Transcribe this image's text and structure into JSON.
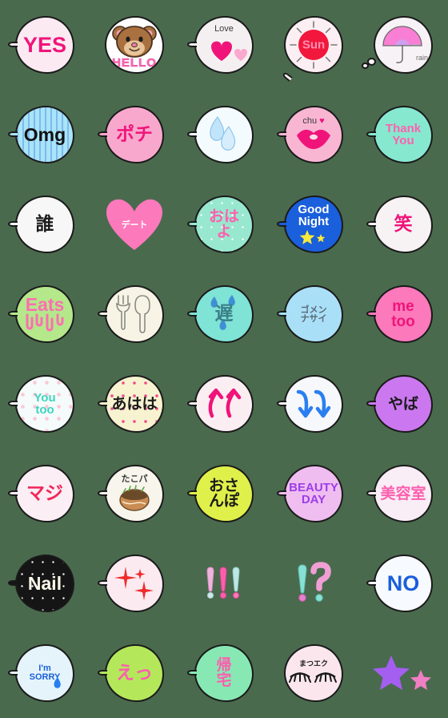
{
  "sheet": {
    "title": "Emoji sticker sheet",
    "columns": 5,
    "rows": 8,
    "background_color": "#4a6a4e",
    "outline_color": "#1a1a1a"
  },
  "emoji": [
    {
      "id": "yes",
      "row": 1,
      "col": 1,
      "text": "YES",
      "kind": "text",
      "shape": "bubble",
      "bubble_color": "#fbeaf2",
      "text_color": "#f0147a",
      "font_size": "s-xl",
      "script": "en",
      "tail": "left"
    },
    {
      "id": "hello-bear",
      "row": 1,
      "col": 2,
      "text": "HELLO",
      "kind": "bear",
      "shape": "bubble",
      "bubble_color": "#ffffff",
      "text_color": "#ff6bb5",
      "font_size": "s-sm",
      "script": "en",
      "tail": "none"
    },
    {
      "id": "love-hearts",
      "row": 1,
      "col": 3,
      "text": "Love",
      "kind": "hearts",
      "shape": "bubble",
      "bubble_color": "#f4f0f2",
      "text_color": "#3a3a3a",
      "font_size": "s-xs",
      "script": "en",
      "tail": "left"
    },
    {
      "id": "sun",
      "row": 1,
      "col": 4,
      "text": "Sun",
      "kind": "sun",
      "shape": "bubble",
      "bubble_color": "#fbeff3",
      "text_color": "#ff8fb0",
      "font_size": "s-sm",
      "script": "en",
      "tail": "bottom"
    },
    {
      "id": "rain-umbrella",
      "row": 1,
      "col": 5,
      "text": "rain",
      "kind": "umbrella",
      "shape": "bubble",
      "bubble_color": "#f7f2f6",
      "text_color": "#6b6b6b",
      "font_size": "s-xxs",
      "script": "en",
      "tail": "thought"
    },
    {
      "id": "omg",
      "row": 2,
      "col": 1,
      "text": "Omg",
      "kind": "text",
      "shape": "bubble",
      "bubble_color": "#a9e4f7",
      "text_color": "#111111",
      "font_size": "s-lg",
      "script": "en",
      "tail": "left",
      "overlay": "stripes"
    },
    {
      "id": "pochi",
      "row": 2,
      "col": 2,
      "text": "ポチ",
      "kind": "text",
      "shape": "bubble",
      "bubble_color": "#f9a8cd",
      "text_color": "#f0147a",
      "font_size": "s-lg",
      "script": "jp",
      "tail": "left"
    },
    {
      "id": "tears",
      "row": 2,
      "col": 3,
      "text": "",
      "kind": "tears",
      "shape": "bubble",
      "bubble_color": "#f4fbff",
      "text_color": "#6fb7e8",
      "font_size": "s-sm",
      "script": "en",
      "tail": "left"
    },
    {
      "id": "chu-kiss",
      "row": 2,
      "col": 4,
      "text": "chu",
      "kind": "lips",
      "shape": "bubble",
      "bubble_color": "#f9b6d3",
      "text_color": "#3a3a3a",
      "font_size": "s-xs",
      "script": "en",
      "tail": "left"
    },
    {
      "id": "thank-you",
      "row": 2,
      "col": 5,
      "text": "Thank\nYou",
      "kind": "text",
      "shape": "bubble",
      "bubble_color": "#87e8d0",
      "text_color": "#ff5fae",
      "font_size": "s-sm",
      "script": "en",
      "tail": "left"
    },
    {
      "id": "dare",
      "row": 3,
      "col": 1,
      "text": "誰",
      "kind": "text",
      "shape": "bubble",
      "bubble_color": "#f7f7f7",
      "text_color": "#1a1a1a",
      "font_size": "s-lg",
      "script": "jp",
      "tail": "left"
    },
    {
      "id": "date",
      "row": 3,
      "col": 2,
      "text": "デート",
      "kind": "text",
      "shape": "heart",
      "bubble_color": "#fc79bb",
      "text_color": "#ffffff",
      "font_size": "s-xs",
      "script": "jp",
      "tail": "none"
    },
    {
      "id": "ohayo",
      "row": 3,
      "col": 3,
      "text": "おは\nよ",
      "kind": "text",
      "shape": "bubble",
      "bubble_color": "#97e8cf",
      "text_color": "#ff5fae",
      "font_size": "s-md",
      "script": "jp",
      "tail": "left",
      "overlay": "nightdots"
    },
    {
      "id": "good-night",
      "row": 3,
      "col": 4,
      "text": "Good\nNight",
      "kind": "night",
      "shape": "bubble",
      "bubble_color": "#1a5fdb",
      "text_color": "#ffffff",
      "font_size": "s-sm",
      "script": "en",
      "tail": "left"
    },
    {
      "id": "warai",
      "row": 3,
      "col": 5,
      "text": "笑",
      "kind": "text",
      "shape": "bubble",
      "bubble_color": "#f7f2f4",
      "text_color": "#f0147a",
      "font_size": "s-lg",
      "script": "jp",
      "tail": "left"
    },
    {
      "id": "eats",
      "row": 4,
      "col": 1,
      "text": "Eats",
      "kind": "drip",
      "shape": "bubble",
      "bubble_color": "#b4e88b",
      "text_color": "#fc6fb0",
      "font_size": "s-lg",
      "script": "en",
      "tail": "left"
    },
    {
      "id": "fork-spoon",
      "row": 4,
      "col": 2,
      "text": "",
      "kind": "cutlery",
      "shape": "bubble",
      "bubble_color": "#f7f4e6",
      "text_color": "#8a8a82",
      "font_size": "s-sm",
      "script": "en",
      "tail": "left"
    },
    {
      "id": "okure",
      "row": 4,
      "col": 3,
      "text": "遅",
      "kind": "sweat",
      "shape": "bubble",
      "bubble_color": "#7fe3d6",
      "text_color": "#3a7f88",
      "font_size": "s-lg",
      "script": "jp",
      "tail": "left"
    },
    {
      "id": "gomennasai",
      "row": 4,
      "col": 4,
      "text": "ゴメン\nナサイ",
      "kind": "text",
      "shape": "bubble",
      "bubble_color": "#a9e0f7",
      "text_color": "#5a6a7a",
      "font_size": "s-xs",
      "script": "jp",
      "tail": "left"
    },
    {
      "id": "me-too",
      "row": 4,
      "col": 5,
      "text": "me\ntoo",
      "kind": "text",
      "shape": "bubble",
      "bubble_color": "#fc79bb",
      "text_color": "#f0147a",
      "font_size": "s-md",
      "script": "en",
      "tail": "left"
    },
    {
      "id": "you-too",
      "row": 5,
      "col": 1,
      "text": "You\ntoo",
      "kind": "text",
      "shape": "bubble",
      "bubble_color": "#f4fbfa",
      "text_color": "#3fd4bf",
      "font_size": "s-sm",
      "script": "en",
      "tail": "left",
      "overlay": "dots"
    },
    {
      "id": "ahaha",
      "row": 5,
      "col": 2,
      "text": "あはは",
      "kind": "text",
      "shape": "bubble",
      "bubble_color": "#f7f2cf",
      "text_color": "#1a1a1a",
      "font_size": "s-md",
      "script": "jp",
      "tail": "left",
      "overlay": "starfield"
    },
    {
      "id": "up-arrows",
      "row": 5,
      "col": 3,
      "text": "",
      "kind": "arrows-up",
      "shape": "bubble",
      "bubble_color": "#fbeef2",
      "text_color": "#f0147a",
      "font_size": "s-md",
      "script": "en",
      "tail": "left"
    },
    {
      "id": "down-arrows",
      "row": 5,
      "col": 4,
      "text": "",
      "kind": "arrows-down",
      "shape": "bubble",
      "bubble_color": "#f7f8fc",
      "text_color": "#2a7ff0",
      "font_size": "s-md",
      "script": "en",
      "tail": "left"
    },
    {
      "id": "yaba",
      "row": 5,
      "col": 5,
      "text": "やば",
      "kind": "text",
      "shape": "bubble",
      "bubble_color": "#cb78f0",
      "text_color": "#1a1a1a",
      "font_size": "s-md",
      "script": "jp",
      "tail": "left"
    },
    {
      "id": "maji",
      "row": 6,
      "col": 1,
      "text": "マジ",
      "kind": "text",
      "shape": "bubble",
      "bubble_color": "#fbeef4",
      "text_color": "#f0285a",
      "font_size": "s-lg",
      "script": "jp",
      "tail": "left"
    },
    {
      "id": "takopa",
      "row": 6,
      "col": 2,
      "text": "たこパ",
      "kind": "takoyaki",
      "shape": "bubble",
      "bubble_color": "#f7f5ec",
      "text_color": "#3a3a3a",
      "font_size": "s-xs",
      "script": "jp",
      "tail": "left"
    },
    {
      "id": "osanpo",
      "row": 6,
      "col": 3,
      "text": "おさ\nんぽ",
      "kind": "text",
      "shape": "bubble",
      "bubble_color": "#e0f04a",
      "text_color": "#1a1a1a",
      "font_size": "s-md",
      "script": "jp",
      "tail": "left"
    },
    {
      "id": "beauty-day",
      "row": 6,
      "col": 4,
      "text": "BEAUTY\nDAY",
      "kind": "text",
      "shape": "bubble",
      "bubble_color": "#f0bdf0",
      "text_color": "#9b3fe8",
      "font_size": "s-sm",
      "script": "en",
      "tail": "left"
    },
    {
      "id": "biyoushitsu",
      "row": 6,
      "col": 5,
      "text": "美容室",
      "kind": "text",
      "shape": "bubble",
      "bubble_color": "#faeef6",
      "text_color": "#fc5fae",
      "font_size": "s-md",
      "script": "jp",
      "tail": "left"
    },
    {
      "id": "nail",
      "row": 7,
      "col": 1,
      "text": "Nail",
      "kind": "text",
      "shape": "bubble",
      "bubble_color": "#151515",
      "text_color": "#fbf7e8",
      "font_size": "s-lg",
      "script": "en",
      "tail": "left",
      "overlay": "nightdots"
    },
    {
      "id": "sparkles",
      "row": 7,
      "col": 2,
      "text": "",
      "kind": "sparkles",
      "shape": "bubble",
      "bubble_color": "#fbeaf0",
      "text_color": "#f02a2a",
      "font_size": "s-sm",
      "script": "en",
      "tail": "left"
    },
    {
      "id": "exclamations",
      "row": 7,
      "col": 3,
      "text": "!!!",
      "kind": "bangs",
      "shape": "none",
      "bubble_color": "transparent",
      "text_color": "#fc79bb",
      "font_size": "s-lg",
      "script": "en",
      "tail": "none"
    },
    {
      "id": "interrobang",
      "row": 7,
      "col": 4,
      "text": "!?",
      "kind": "interrobang",
      "shape": "none",
      "bubble_color": "transparent",
      "text_color": "#f9a8cd",
      "font_size": "s-lg",
      "script": "en",
      "tail": "none"
    },
    {
      "id": "no",
      "row": 7,
      "col": 5,
      "text": "NO",
      "kind": "text",
      "shape": "bubble",
      "bubble_color": "#f7faff",
      "text_color": "#1a5fdb",
      "font_size": "s-xl",
      "script": "en",
      "tail": "left"
    },
    {
      "id": "im-sorry",
      "row": 8,
      "col": 1,
      "text": "I'm\nSORRY",
      "kind": "sorry",
      "shape": "bubble",
      "bubble_color": "#e4f4fa",
      "text_color": "#1a5fdb",
      "font_size": "s-xs",
      "script": "en",
      "tail": "left"
    },
    {
      "id": "eh",
      "row": 8,
      "col": 2,
      "text": "えっ",
      "kind": "text",
      "shape": "bubble",
      "bubble_color": "#b4e85a",
      "text_color": "#fc5fae",
      "font_size": "s-lg",
      "script": "jp",
      "tail": "left"
    },
    {
      "id": "kitaku",
      "row": 8,
      "col": 3,
      "text": "帰\n宅",
      "kind": "text",
      "shape": "bubble",
      "bubble_color": "#87e8b4",
      "text_color": "#fc5fae",
      "font_size": "s-md",
      "script": "jp",
      "tail": "left"
    },
    {
      "id": "matsueku",
      "row": 8,
      "col": 4,
      "text": "まつエク",
      "kind": "lashes",
      "shape": "bubble",
      "bubble_color": "#fbe6ee",
      "text_color": "#1a1a1a",
      "font_size": "s-xxs",
      "script": "jp",
      "tail": "none"
    },
    {
      "id": "stars",
      "row": 8,
      "col": 5,
      "text": "",
      "kind": "stars",
      "shape": "none",
      "bubble_color": "transparent",
      "text_color": "#a45ff0",
      "font_size": "s-lg",
      "script": "en",
      "tail": "none"
    }
  ],
  "palette": {
    "hot_pink": "#f0147a",
    "pink": "#fc79bb",
    "mint": "#87e8d0",
    "blue": "#1a5fdb",
    "purple": "#cb78f0",
    "green": "#b4e85a",
    "yellow_green": "#e0f04a",
    "black": "#151515"
  }
}
